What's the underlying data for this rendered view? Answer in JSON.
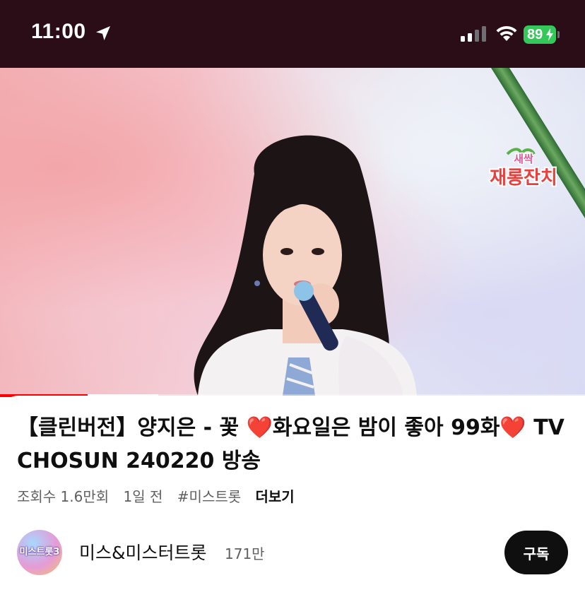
{
  "status_bar": {
    "time": "11:00",
    "battery": "89"
  },
  "video": {
    "show_logo_text": "새싹 재롱잔치",
    "progress_played": 0.15,
    "progress_buffered": 0.27
  },
  "info": {
    "title": "【클린버전】양지은 - 꽃 ❤️화요일은 밤이 좋아 99화❤️ TV CHOSUN 240220 방송",
    "views": "조회수 1.6만회",
    "age": "1일 전",
    "hashtag": "#미스트롯",
    "more": "더보기"
  },
  "channel": {
    "avatar_text": "미스트롯3",
    "name": "미스&미스터트롯",
    "subscribers": "171만",
    "subscribe_label": "구독"
  },
  "colors": {
    "status_bar_bg": "#2a0d16",
    "battery_green": "#34c759",
    "progress_red": "#ff0000",
    "subscribe_bg": "#0f0f0f"
  }
}
